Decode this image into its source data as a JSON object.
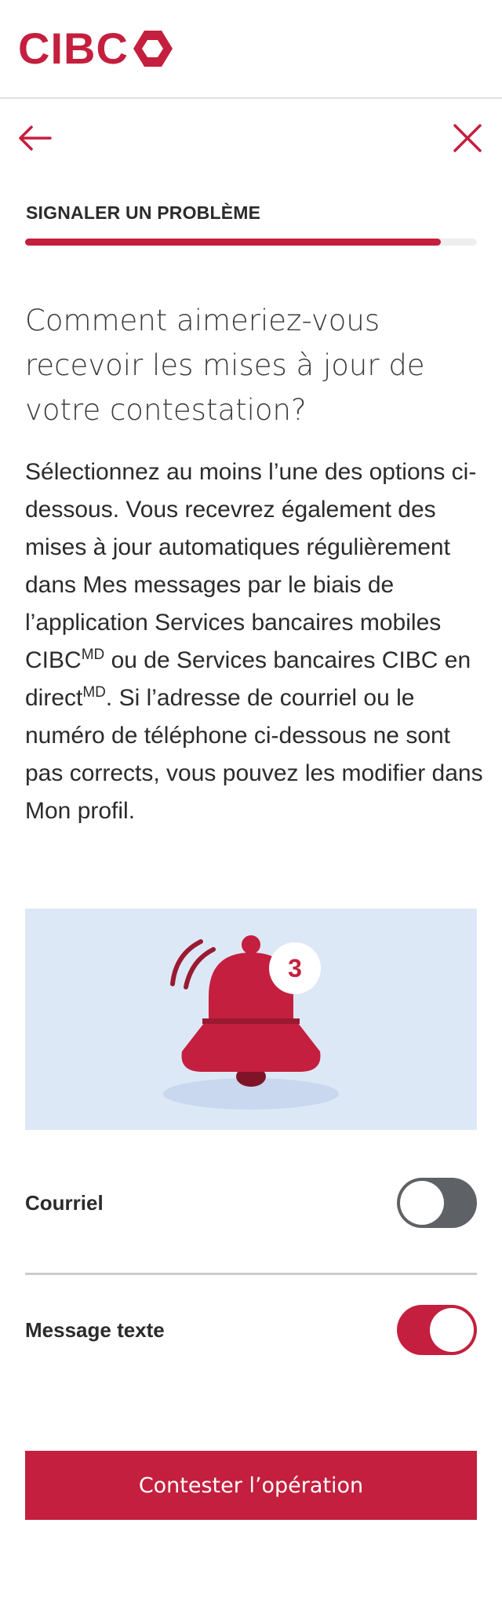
{
  "brand": {
    "name": "CIBC",
    "color": "#c41f3e"
  },
  "nav": {
    "back_icon": "arrow-left-icon",
    "close_icon": "close-icon"
  },
  "step": {
    "label": "SIGNALER UN PROBLÈME",
    "progress": 0.92
  },
  "main": {
    "heading": "Comment aimeriez-vous recevoir les mises à jour de votre contestation?",
    "body_part1": "Sélectionnez au moins l’une des options ci-dessous. Vous recevrez également des mises à jour automatiques régulièrement dans Mes messages par le biais de l’application Services bancaires mobiles CIBC",
    "body_sup1": "MD",
    "body_part2": " ou de Services bancaires CIBC en direct",
    "body_sup2": "MD",
    "body_part3": ". Si l’adresse de courriel ou le numéro de téléphone ci-dessous ne sont pas corrects, vous pouvez les modifier dans Mon profil."
  },
  "illustration": {
    "icon": "notification-bell-icon",
    "badge_count": "3"
  },
  "options": [
    {
      "label": "Courriel",
      "enabled": false
    },
    {
      "label": "Message texte",
      "enabled": true
    }
  ],
  "cta": {
    "label": "Contester l’opération"
  }
}
